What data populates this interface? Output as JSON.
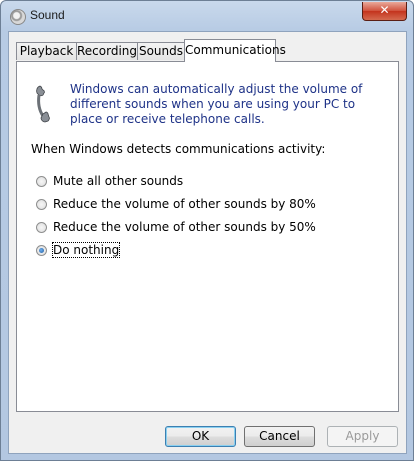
{
  "window": {
    "title": "Sound",
    "close_label": "✕"
  },
  "tabs": [
    {
      "label": "Playback",
      "active": false
    },
    {
      "label": "Recording",
      "active": false
    },
    {
      "label": "Sounds",
      "active": false
    },
    {
      "label": "Communications",
      "active": true
    }
  ],
  "panel": {
    "icon": "telephone-handset-icon",
    "description": "Windows can automatically adjust the volume of different sounds when you are using your PC to place or receive telephone calls.",
    "prompt": "When Windows detects communications activity:",
    "options": [
      {
        "label": "Mute all other sounds",
        "checked": false
      },
      {
        "label": "Reduce the volume of other sounds by 80%",
        "checked": false
      },
      {
        "label": "Reduce the volume of other sounds by 50%",
        "checked": false
      },
      {
        "label": "Do nothing",
        "checked": true
      }
    ]
  },
  "buttons": {
    "ok": "OK",
    "cancel": "Cancel",
    "apply": "Apply"
  },
  "colors": {
    "description_text": "#1e3287",
    "title_bar": "#b7cbe4",
    "close_button": "#c4331d"
  }
}
